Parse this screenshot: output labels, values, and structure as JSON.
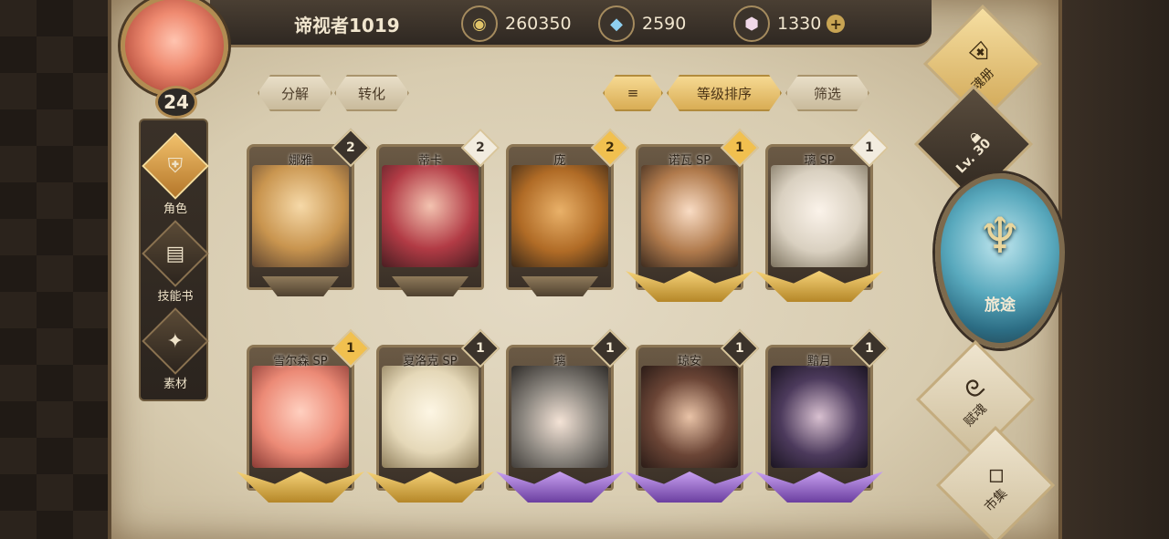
{
  "player": {
    "name": "谛视者1019",
    "level": "24"
  },
  "currencies": [
    {
      "icon": "gold-coin-icon",
      "value": "260350"
    },
    {
      "icon": "blue-crystal-icon",
      "value": "2590"
    },
    {
      "icon": "prism-gem-icon",
      "value": "1330"
    }
  ],
  "plus_label": "+",
  "sidenav": [
    {
      "label": "角色",
      "icon": "helmet-icon",
      "active": true
    },
    {
      "label": "技能书",
      "icon": "book-icon",
      "active": false
    },
    {
      "label": "素材",
      "icon": "material-icon",
      "active": false
    }
  ],
  "tabs": {
    "decompose": "分解",
    "convert": "转化",
    "sort_order": "等级排序",
    "filter": "筛选",
    "sort_icon": "≡"
  },
  "cards": [
    {
      "name": "娜雅",
      "count": "2",
      "badge": "dark",
      "wings": "none"
    },
    {
      "name": "蒂卡",
      "count": "2",
      "badge": "light",
      "wings": "none"
    },
    {
      "name": "庞",
      "count": "2",
      "badge": "gold",
      "wings": "none"
    },
    {
      "name": "诺瓦 SP",
      "count": "1",
      "badge": "gold",
      "wings": "gold"
    },
    {
      "name": "璃 SP",
      "count": "1",
      "badge": "light",
      "wings": "gold"
    },
    {
      "name": "雪尔森 SP",
      "count": "1",
      "badge": "gold",
      "wings": "gold"
    },
    {
      "name": "夏洛克 SP",
      "count": "1",
      "badge": "dark",
      "wings": "gold"
    },
    {
      "name": "璃",
      "count": "1",
      "badge": "dark",
      "wings": "purple"
    },
    {
      "name": "琼安",
      "count": "1",
      "badge": "dark",
      "wings": "purple"
    },
    {
      "name": "黯月",
      "count": "1",
      "badge": "dark",
      "wings": "purple"
    }
  ],
  "right_menu": {
    "soul_book": "魂册",
    "locked_level": "Lv. 30",
    "journey": "旅途",
    "soul_gift": "赋魂",
    "market": "市集"
  },
  "colors": {
    "accent_gold": "#f1c04f",
    "parchment": "#e4dac4",
    "journey_blue": "#59a9bd",
    "rare_purple": "#6b3fa0"
  }
}
